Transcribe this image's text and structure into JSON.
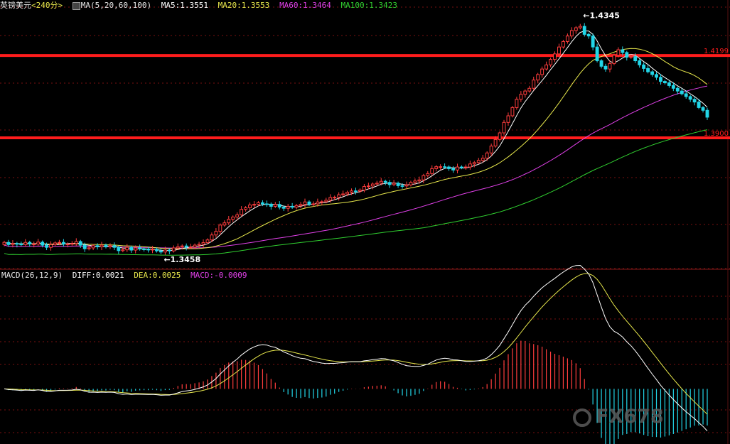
{
  "header": {
    "symbol": "英镑美元",
    "period": "<240分>",
    "ma_label": "MA(5,20,60,100)",
    "ma5": "MA5:1.3551",
    "ma20": "MA20:1.3553",
    "ma60": "MA60:1.3464",
    "ma100": "MA100:1.3423"
  },
  "macd_header": {
    "label": "MACD(26,12,9)",
    "diff": "DIFF:0.0021",
    "dea": "DEA:0.0025",
    "macd": "MACD:-0.0009"
  },
  "watermark": "FX678",
  "colors": {
    "background": "#000000",
    "up": "#ff3d3d",
    "down": "#22d6e8",
    "ma5": "#ffffff",
    "ma20": "#e8e84c",
    "ma60": "#e040e8",
    "ma100": "#30d030",
    "level": "#ff1c1c",
    "grid": "#7a1010"
  },
  "chart_data": [
    {
      "type": "candlestick",
      "y_range": [
        1.3425,
        1.4375
      ],
      "x": [
        1,
        2,
        3,
        4,
        5,
        6,
        7,
        8,
        9,
        10,
        11,
        12,
        13,
        14,
        15,
        16,
        17,
        18,
        19,
        20,
        21,
        22,
        23,
        24,
        25,
        26,
        27,
        28,
        29,
        30,
        31,
        32,
        33,
        34,
        35,
        36,
        37,
        38,
        39,
        40,
        41,
        42,
        43,
        44,
        45,
        46,
        47,
        48,
        49,
        50,
        51,
        52,
        53,
        54,
        55,
        56,
        57,
        58,
        59,
        60,
        61,
        62,
        63,
        64,
        65,
        66,
        67,
        68,
        69,
        70,
        71,
        72,
        73,
        74,
        75,
        76,
        77,
        78,
        79,
        80,
        81,
        82,
        83,
        84,
        85,
        86,
        87,
        88,
        89,
        90,
        91,
        92,
        93,
        94,
        95,
        96,
        97,
        98,
        99,
        100,
        101,
        102,
        103,
        104,
        105,
        106,
        107,
        108,
        109,
        110,
        111,
        112,
        113,
        114,
        115,
        116,
        117,
        118,
        119,
        120,
        121,
        122,
        123,
        124,
        125,
        126,
        127,
        128,
        129,
        130,
        131,
        132,
        133,
        134,
        135,
        136,
        137,
        138,
        139,
        140,
        141,
        142,
        143,
        144,
        145,
        146,
        147,
        148,
        149,
        150,
        151,
        152,
        153,
        154,
        155,
        156,
        157,
        158,
        159,
        160,
        161,
        162,
        163,
        164,
        165
      ],
      "open": [
        1.3512,
        1.352,
        1.3512,
        1.3516,
        1.3514,
        1.3512,
        1.352,
        1.3514,
        1.3514,
        1.3521,
        1.351,
        1.3502,
        1.3512,
        1.3518,
        1.352,
        1.3514,
        1.3514,
        1.3516,
        1.3523,
        1.351,
        1.3497,
        1.35,
        1.3508,
        1.3504,
        1.351,
        1.3504,
        1.3508,
        1.3502,
        1.349,
        1.3493,
        1.3502,
        1.3492,
        1.35,
        1.3496,
        1.3495,
        1.3493,
        1.3495,
        1.3489,
        1.3485,
        1.3492,
        1.3489,
        1.35,
        1.3504,
        1.3507,
        1.3503,
        1.3503,
        1.351,
        1.3513,
        1.3519,
        1.3529,
        1.3547,
        1.356,
        1.3583,
        1.3591,
        1.3604,
        1.3612,
        1.362,
        1.364,
        1.3646,
        1.3656,
        1.3658,
        1.3664,
        1.366,
        1.3659,
        1.3651,
        1.3658,
        1.3648,
        1.3644,
        1.3651,
        1.3648,
        1.3654,
        1.3658,
        1.3667,
        1.3658,
        1.366,
        1.3667,
        1.3668,
        1.3673,
        1.3683,
        1.3684,
        1.3693,
        1.3696,
        1.3702,
        1.3707,
        1.3706,
        1.371,
        1.3723,
        1.3725,
        1.3732,
        1.3735,
        1.3742,
        1.3738,
        1.373,
        1.3735,
        1.3726,
        1.3725,
        1.3729,
        1.3738,
        1.3743,
        1.3747,
        1.3763,
        1.377,
        1.3788,
        1.3795,
        1.3795,
        1.3794,
        1.3788,
        1.3783,
        1.3794,
        1.3792,
        1.3794,
        1.3805,
        1.381,
        1.3818,
        1.3826,
        1.3845,
        1.387,
        1.3894,
        1.3918,
        1.3956,
        1.398,
        1.401,
        1.404,
        1.4058,
        1.407,
        1.408,
        1.411,
        1.413,
        1.415,
        1.4165,
        1.4185,
        1.4205,
        1.423,
        1.425,
        1.427,
        1.429,
        1.43,
        1.4305,
        1.4276,
        1.427,
        1.423,
        1.418,
        1.416,
        1.415,
        1.417,
        1.42,
        1.422,
        1.421,
        1.4193,
        1.4195,
        1.418,
        1.4165,
        1.4152,
        1.414,
        1.413,
        1.412,
        1.4105,
        1.41,
        1.409,
        1.408,
        1.407,
        1.406,
        1.405,
        1.404,
        1.403,
        1.401,
        1.4
      ],
      "close": [
        1.352,
        1.3512,
        1.3516,
        1.3514,
        1.3512,
        1.352,
        1.3514,
        1.3514,
        1.3521,
        1.351,
        1.3502,
        1.3512,
        1.3518,
        1.352,
        1.3514,
        1.3514,
        1.3516,
        1.3523,
        1.351,
        1.3497,
        1.35,
        1.3508,
        1.3504,
        1.351,
        1.3504,
        1.3508,
        1.3502,
        1.349,
        1.3493,
        1.3502,
        1.3492,
        1.35,
        1.3496,
        1.3495,
        1.3493,
        1.3495,
        1.3489,
        1.3485,
        1.3492,
        1.3489,
        1.35,
        1.3504,
        1.3507,
        1.3503,
        1.3503,
        1.351,
        1.3513,
        1.3519,
        1.3529,
        1.3547,
        1.356,
        1.3583,
        1.3591,
        1.3604,
        1.3612,
        1.362,
        1.364,
        1.3646,
        1.3656,
        1.3658,
        1.3664,
        1.366,
        1.3659,
        1.3651,
        1.3658,
        1.3648,
        1.3644,
        1.3651,
        1.3648,
        1.3654,
        1.3658,
        1.3667,
        1.3658,
        1.366,
        1.3667,
        1.3668,
        1.3673,
        1.3683,
        1.3684,
        1.3693,
        1.3696,
        1.3702,
        1.3707,
        1.3706,
        1.371,
        1.3723,
        1.3725,
        1.3732,
        1.3735,
        1.3742,
        1.3738,
        1.373,
        1.3735,
        1.3726,
        1.3725,
        1.3729,
        1.3738,
        1.3743,
        1.3747,
        1.3763,
        1.377,
        1.3788,
        1.3795,
        1.3795,
        1.3794,
        1.3788,
        1.3783,
        1.3794,
        1.3792,
        1.3794,
        1.3805,
        1.381,
        1.3818,
        1.3826,
        1.3845,
        1.387,
        1.3894,
        1.3918,
        1.3956,
        1.398,
        1.401,
        1.404,
        1.4058,
        1.407,
        1.408,
        1.411,
        1.413,
        1.415,
        1.4165,
        1.4185,
        1.4205,
        1.423,
        1.425,
        1.427,
        1.429,
        1.43,
        1.4305,
        1.4276,
        1.427,
        1.423,
        1.418,
        1.416,
        1.415,
        1.417,
        1.42,
        1.422,
        1.421,
        1.4193,
        1.4195,
        1.418,
        1.4165,
        1.4152,
        1.414,
        1.413,
        1.412,
        1.4105,
        1.41,
        1.409,
        1.408,
        1.407,
        1.406,
        1.405,
        1.404,
        1.403,
        1.401,
        1.4,
        1.3975
      ],
      "series": [
        {
          "name": "MA5",
          "values": []
        },
        {
          "name": "MA20",
          "values": []
        },
        {
          "name": "MA60",
          "values": []
        },
        {
          "name": "MA100",
          "values": []
        }
      ],
      "horizontal_levels": [
        1.4199,
        1.39
      ],
      "annotations": [
        {
          "label": "1.4345",
          "value": 1.4345
        },
        {
          "label": "1.3458",
          "value": 1.3458
        }
      ],
      "level_labels": [
        "1.4199",
        "1.3900"
      ]
    },
    {
      "type": "macd",
      "y_range": [
        -0.0045,
        0.01
      ],
      "diff": [],
      "dea": [],
      "histogram": []
    }
  ]
}
